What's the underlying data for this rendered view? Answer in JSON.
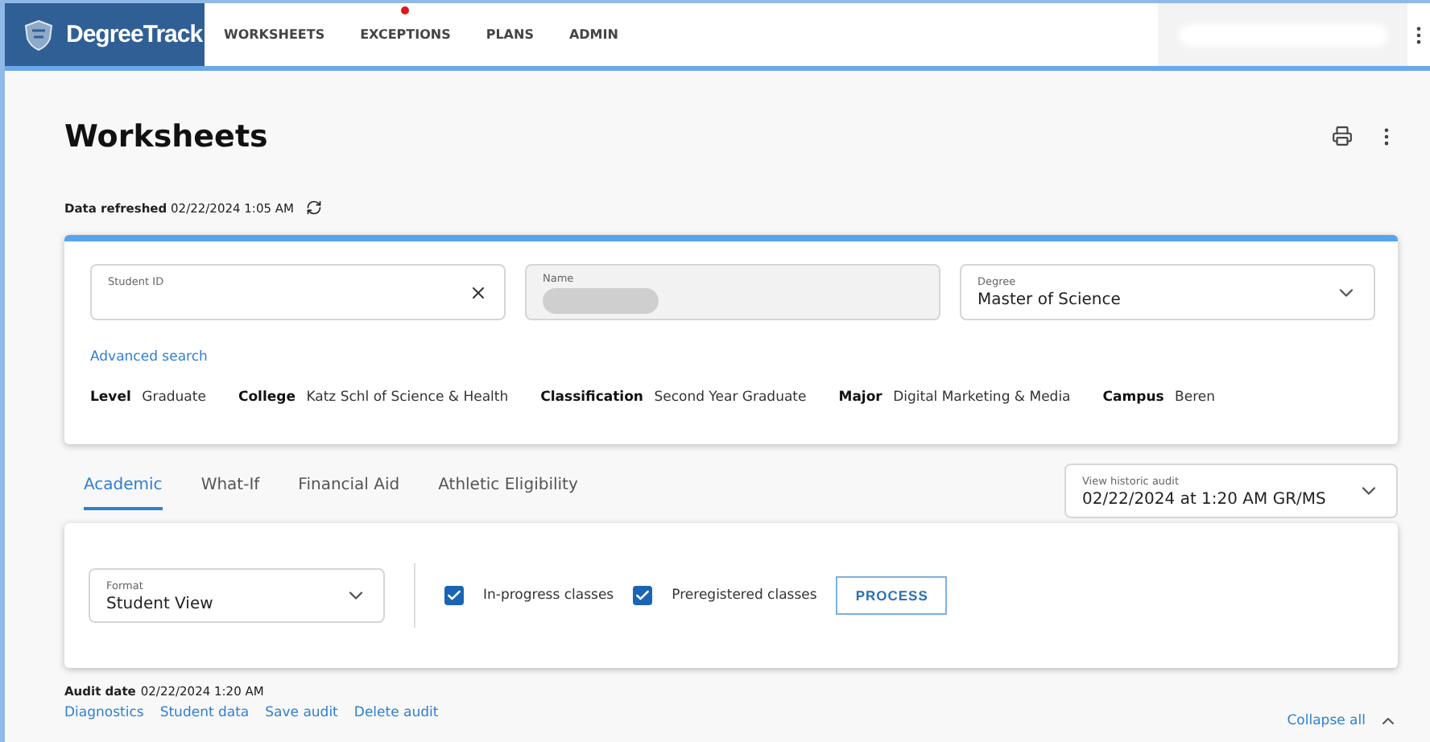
{
  "header": {
    "brand": "DegreeTrack",
    "nav": [
      {
        "label": "WORKSHEETS",
        "alert": false
      },
      {
        "label": "EXCEPTIONS",
        "alert": true
      },
      {
        "label": "PLANS",
        "alert": false
      },
      {
        "label": "ADMIN",
        "alert": false
      }
    ]
  },
  "page": {
    "title": "Worksheets",
    "refreshed_label": "Data refreshed",
    "refreshed_value": "02/22/2024 1:05 AM"
  },
  "student": {
    "student_id": {
      "label": "Student ID"
    },
    "name": {
      "label": "Name",
      "redacted": true
    },
    "degree": {
      "label": "Degree",
      "value": "Master of Science"
    },
    "advanced_search": "Advanced search",
    "facts": [
      {
        "label": "Level",
        "value": "Graduate"
      },
      {
        "label": "College",
        "value": "Katz Schl of Science & Health"
      },
      {
        "label": "Classification",
        "value": "Second Year Graduate"
      },
      {
        "label": "Major",
        "value": "Digital Marketing & Media"
      },
      {
        "label": "Campus",
        "value": "Beren"
      }
    ]
  },
  "tabs": [
    {
      "label": "Academic",
      "selected": true
    },
    {
      "label": "What-If",
      "selected": false
    },
    {
      "label": "Financial Aid",
      "selected": false
    },
    {
      "label": "Athletic Eligibility",
      "selected": false
    }
  ],
  "historic": {
    "label": "View historic audit",
    "value": "02/22/2024 at 1:20 AM GR/MS"
  },
  "options": {
    "format": {
      "label": "Format",
      "value": "Student View"
    },
    "checks": [
      {
        "label": "In-progress classes",
        "checked": true
      },
      {
        "label": "Preregistered classes",
        "checked": true
      }
    ],
    "process": "PROCESS"
  },
  "audit": {
    "label": "Audit date",
    "value": "02/22/2024 1:20 AM",
    "links": [
      "Diagnostics",
      "Student data",
      "Save audit",
      "Delete audit"
    ],
    "collapse": "Collapse all"
  }
}
